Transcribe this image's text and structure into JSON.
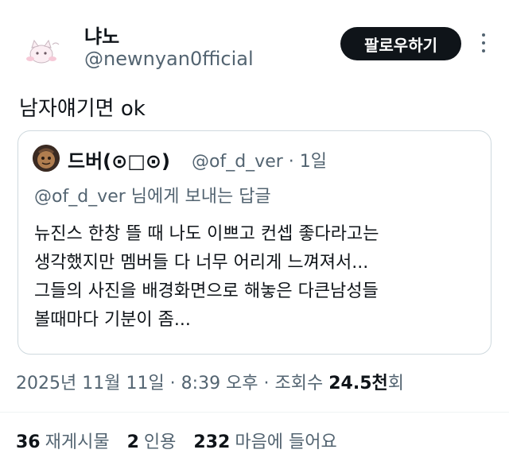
{
  "author": {
    "display_name": "냐노",
    "handle": "@newnyan0fficial",
    "avatar_icon": "kitten-sketch-avatar"
  },
  "follow_button": {
    "label": "팔로우하기"
  },
  "more_icon": "more-vertical-icon",
  "tweet": {
    "text": "남자얘기면 ok"
  },
  "quoted": {
    "display_name": "드버(⊙□⊙)",
    "handle_time": "@of_d_ver · 1일",
    "replying_to": "@of_d_ver 님에게 보내는 답글",
    "body_lines": [
      "뉴진스 한창 뜰 때 나도 이쁘고 컨셉 좋다라고는",
      "생각했지만 멤버들 다 너무 어리게 느껴져서...",
      "그들의 사진을 배경화면으로 해놓은 다큰남성들",
      "볼때마다 기분이 좀..."
    ]
  },
  "meta": {
    "timestamp": "2025년 11월 11일 · 8:39 오후 · 조회수 ",
    "views_value": "24.5천",
    "views_unit": "회"
  },
  "stats": {
    "retweets_count": "36",
    "retweets_label": "재게시물",
    "quotes_count": "2",
    "quotes_label": "인용",
    "likes_count": "232",
    "likes_label": "마음에 들어요"
  },
  "colors": {
    "text_primary": "#0f1419",
    "text_secondary": "#536471",
    "border": "#cfd9de",
    "button_bg": "#0f1419"
  }
}
